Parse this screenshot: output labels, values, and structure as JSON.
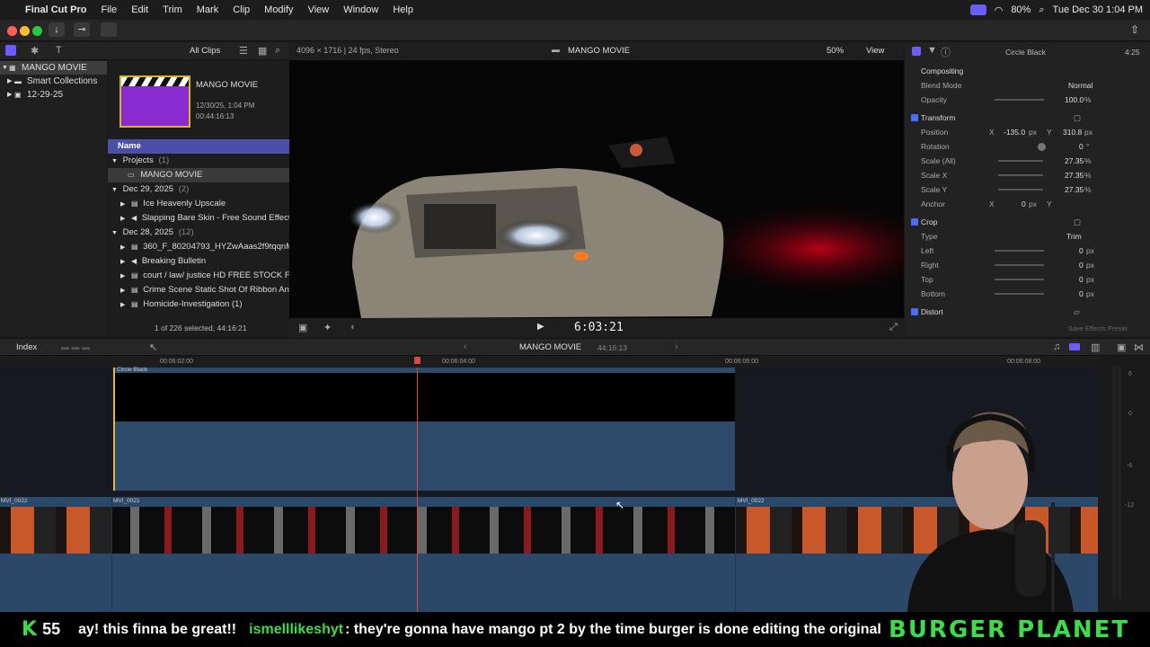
{
  "menubar": {
    "app": "Final Cut Pro",
    "items": [
      "File",
      "Edit",
      "Trim",
      "Mark",
      "Clip",
      "Modify",
      "View",
      "Window",
      "Help"
    ],
    "battery": "80%",
    "datetime": "Tue Dec 30  1:04 PM"
  },
  "browser": {
    "filter": "All Clips",
    "libraries": [
      "MANGO MOVIE",
      "Smart Collections",
      "12-29-25"
    ],
    "project": {
      "name": "MANGO MOVIE",
      "date": "12/30/25, 1:04 PM",
      "duration": "00:44:16:13"
    },
    "column_header": "Name",
    "groups": [
      {
        "label": "Projects",
        "count": "(1)",
        "items": [
          "MANGO MOVIE"
        ]
      },
      {
        "label": "Dec 29, 2025",
        "count": "(2)",
        "items": [
          "Ice Heavenly Upscale",
          "Slapping Bare Skin - Free Sound Effects"
        ]
      },
      {
        "label": "Dec 28, 2025",
        "count": "(12)",
        "items": [
          "360_F_80204793_HYZwAaas2f9tqqnMN",
          "Breaking Bulletin",
          "court / law/ justice HD FREE STOCK FOO",
          "Crime Scene Static Shot Of Ribbon And S",
          "Homicide-Investigation (1)"
        ]
      }
    ],
    "status": "1 of 226 selected, 44:16:21"
  },
  "viewer": {
    "format": "4096 × 1716 | 24 fps, Stereo",
    "title": "MANGO MOVIE",
    "zoom": "50%",
    "view_label": "View",
    "timecode": "6:03:21"
  },
  "inspector": {
    "clip": "Circle Black",
    "duration": "4:25",
    "sections": {
      "compositing": "Compositing",
      "transform": "Transform",
      "crop": "Crop",
      "distort": "Distort"
    },
    "blend_mode_label": "Blend Mode",
    "blend_mode": "Normal",
    "opacity_label": "Opacity",
    "opacity": "100.0",
    "position_label": "Position",
    "pos_x": "-135.0",
    "pos_y": "310.8",
    "rotation_label": "Rotation",
    "rotation": "0",
    "scale_all_label": "Scale (All)",
    "scale_all": "27.35",
    "scale_x_label": "Scale X",
    "scale_x": "27.35",
    "scale_y_label": "Scale Y",
    "scale_y": "27.35",
    "anchor_label": "Anchor",
    "anchor_x": "0",
    "type_label": "Type",
    "crop_type": "Trim",
    "left_label": "Left",
    "left": "0",
    "right_label": "Right",
    "right": "0",
    "top_label": "Top",
    "top": "0",
    "bottom_label": "Bottom",
    "bottom": "0",
    "px": "px",
    "pct": "%",
    "deg": "°",
    "x": "X",
    "y": "Y",
    "save_preset": "Save Effects Preset"
  },
  "timeline": {
    "index": "Index",
    "project": "MANGO MOVIE",
    "duration": "44:16:13",
    "ruler": [
      "00:06:02:00",
      "00:06:04:00",
      "00:06:06:00",
      "00:06:08:00"
    ],
    "clips": {
      "title": "Circle Black",
      "left": "MVI_0022",
      "middle": "MVI_0021",
      "right": "MVI_0022"
    },
    "meter": [
      "6",
      "0",
      "-6",
      "-12"
    ]
  },
  "ticker": {
    "logo": "K",
    "viewers": "55",
    "msg1": "ay! this finna be great!!",
    "user": "ismelllikeshyt",
    "msg2": ": they're gonna have mango pt 2 by the time burger is done editing the original",
    "brand": "BURGER PLANET"
  },
  "colors": {
    "accent": "#6a5cff",
    "selection": "#4a4fa8",
    "playhead": "#d94a3a",
    "ticker_green": "#3ddc4a",
    "clip_blue": "#2d4a6a"
  }
}
